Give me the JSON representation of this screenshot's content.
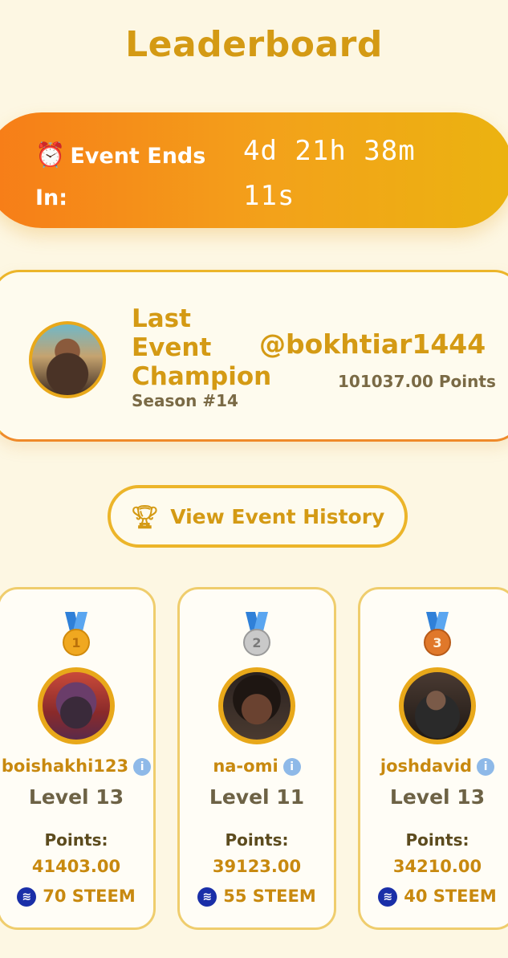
{
  "page": {
    "title": "Leaderboard"
  },
  "countdown": {
    "icon": "alarm-clock-icon",
    "label_line1": "Event Ends",
    "label_line2": "In:",
    "time_line1": "4d 21h 38m",
    "time_line2": "11s"
  },
  "champion": {
    "title_line1": "Last",
    "title_line2": "Event",
    "title_line3": "Champion",
    "season": "Season #14",
    "username": "@bokhtiar1444",
    "points": "101037.00 Points"
  },
  "history_button": {
    "icon": "trophy-icon",
    "label": "View Event History"
  },
  "leaders": [
    {
      "rank_icon": "gold-medal-icon",
      "rank": "1",
      "username": "boishakhi123",
      "level": "Level 13",
      "points_label": "Points:",
      "points": "41403.00",
      "reward": "70 STEEM",
      "medal_color": "#f0a820"
    },
    {
      "rank_icon": "silver-medal-icon",
      "rank": "2",
      "username": "na-omi",
      "level": "Level 11",
      "points_label": "Points:",
      "points": "39123.00",
      "reward": "55 STEEM",
      "medal_color": "#b9b9b9"
    },
    {
      "rank_icon": "bronze-medal-icon",
      "rank": "3",
      "username": "joshdavid",
      "level": "Level 13",
      "points_label": "Points:",
      "points": "34210.00",
      "reward": "40 STEEM",
      "medal_color": "#e0782a"
    }
  ],
  "colors": {
    "accent": "#d49a14",
    "background": "#fdf7e3",
    "gradient_start": "#f77c18",
    "gradient_end": "#ebb310"
  }
}
